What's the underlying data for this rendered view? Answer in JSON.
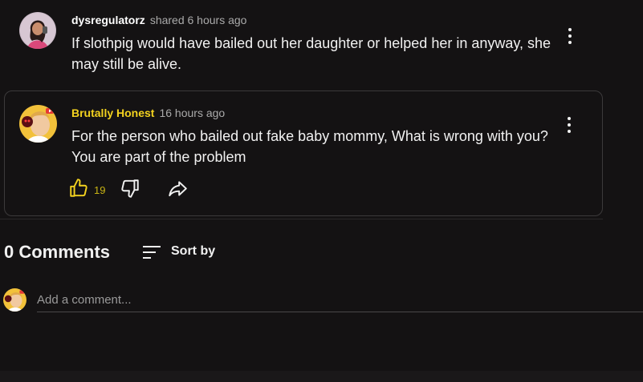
{
  "post": {
    "author": "dysregulatorz",
    "meta": "shared 6 hours ago",
    "text": "If slothpig would have bailed out her daughter or helped her in anyway, she may still be alive."
  },
  "reply": {
    "author": "Brutally Honest",
    "time": "16 hours ago",
    "text": "For the person who bailed out fake baby mommy, What is wrong with you? You are part of the problem",
    "like_count": "19"
  },
  "comments": {
    "count_label": "0 Comments",
    "sort_label": "Sort by",
    "input_placeholder": "Add a comment..."
  },
  "icons": {
    "like": "thumbs-up-icon",
    "dislike": "thumbs-down-icon",
    "share": "share-arrow-icon",
    "more": "more-vertical-icon",
    "sort": "sort-lines-icon"
  },
  "colors": {
    "background": "#141213",
    "accent_yellow": "#f3d21f",
    "text": "#f1f1f1",
    "muted": "#aaaaaa"
  }
}
